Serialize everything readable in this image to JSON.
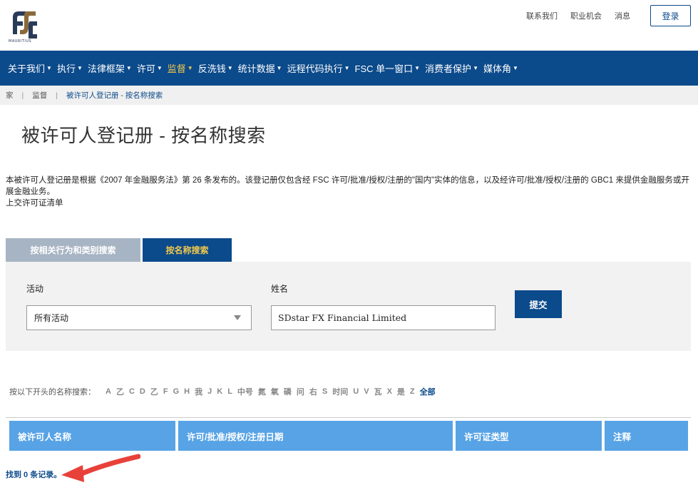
{
  "header": {
    "logo_text": "MAURITIUS",
    "top_links": [
      "联系我们",
      "职业机会",
      "消息"
    ],
    "login_label": "登录"
  },
  "nav": {
    "items": [
      {
        "label": "关于我们",
        "caret": true,
        "active": false
      },
      {
        "label": "执行",
        "caret": true,
        "active": false
      },
      {
        "label": "法律框架",
        "caret": true,
        "active": false
      },
      {
        "label": "许可",
        "caret": true,
        "active": false
      },
      {
        "label": "监督",
        "caret": true,
        "active": true
      },
      {
        "label": "反洗钱",
        "caret": true,
        "active": false
      },
      {
        "label": "统计数据",
        "caret": true,
        "active": false
      },
      {
        "label": "远程代码执行",
        "caret": true,
        "active": false
      },
      {
        "label": "FSC 单一窗口",
        "caret": true,
        "active": false
      },
      {
        "label": "消费者保护",
        "caret": true,
        "active": false
      },
      {
        "label": "媒体角",
        "caret": true,
        "active": false
      }
    ]
  },
  "breadcrumb": [
    "家",
    "监督",
    "被许可人登记册 - 按名称搜索"
  ],
  "page_title": "被许可人登记册 - 按名称搜索",
  "description": {
    "line1": "本被许可人登记册是根据《2007 年金融服务法》第 26 条发布的。该登记册仅包含经 FSC 许可/批准/授权/注册的\"国内\"实体的信息，以及经许可/批准/授权/注册的 GBC1 来提供金融服务或开展金融业务。",
    "line2": "上交许可证清单"
  },
  "tabs": {
    "by_activity": "按相关行为和类别搜索",
    "by_name": "按名称搜索"
  },
  "search": {
    "activity_label": "活动",
    "activity_value": "所有活动",
    "name_label": "姓名",
    "name_value": "SDstar FX Financial Limited",
    "submit_label": "提交"
  },
  "alphabet": {
    "label": "按以下开头的名称搜索：",
    "letters": [
      "A",
      "乙",
      "C",
      "D",
      "乙",
      "F",
      "G",
      "H",
      "我",
      "J",
      "K",
      "L",
      "中号",
      "氮",
      "氧",
      "磷",
      "问",
      "右",
      "S",
      "时间",
      "U",
      "V",
      "瓦",
      "X",
      "是",
      "Z"
    ],
    "all_label": "全部"
  },
  "table": {
    "columns": [
      "被许可人名称",
      "许可/批准/授权/注册日期",
      "许可证类型",
      "注释"
    ]
  },
  "records_text": "找到 0 条记录。",
  "colors": {
    "nav_bg": "#0b4a8b",
    "active_nav": "#f2c84b",
    "table_header": "#57a3e6",
    "annotation_arrow": "#e8413a"
  }
}
